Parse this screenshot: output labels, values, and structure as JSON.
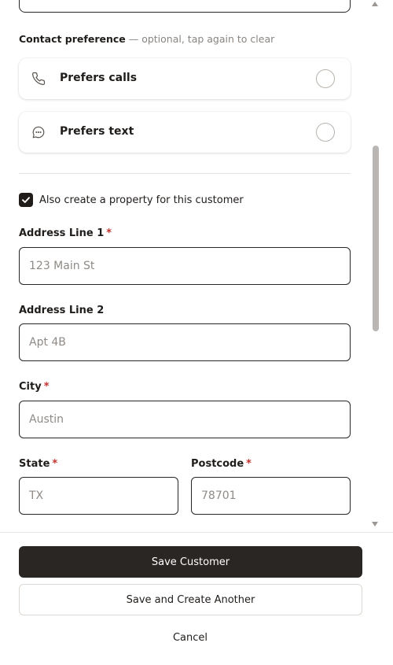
{
  "contact_preference": {
    "heading": "Contact preference",
    "hint": " — optional, tap again to clear",
    "options": [
      {
        "label": "Prefers calls",
        "icon": "phone-icon",
        "selected": false
      },
      {
        "label": "Prefers text",
        "icon": "chat-bubble-icon",
        "selected": false
      }
    ]
  },
  "property": {
    "checkbox_label": "Also create a property for this customer",
    "checked": true
  },
  "fields": {
    "address_line_1": {
      "label": "Address Line 1",
      "required": "*",
      "placeholder": "123 Main St",
      "value": ""
    },
    "address_line_2": {
      "label": "Address Line 2",
      "placeholder": "Apt 4B",
      "value": ""
    },
    "city": {
      "label": "City",
      "required": "*",
      "placeholder": "Austin",
      "value": ""
    },
    "state": {
      "label": "State",
      "required": "*",
      "placeholder": "TX",
      "value": ""
    },
    "postcode": {
      "label": "Postcode",
      "required": "*",
      "placeholder": "78701",
      "value": ""
    }
  },
  "actions": {
    "save": "Save Customer",
    "save_another": "Save and Create Another",
    "cancel": "Cancel"
  },
  "colors": {
    "primary_button": "#2a2624",
    "required_mark": "#c2332f",
    "muted_text": "#8a8480"
  }
}
